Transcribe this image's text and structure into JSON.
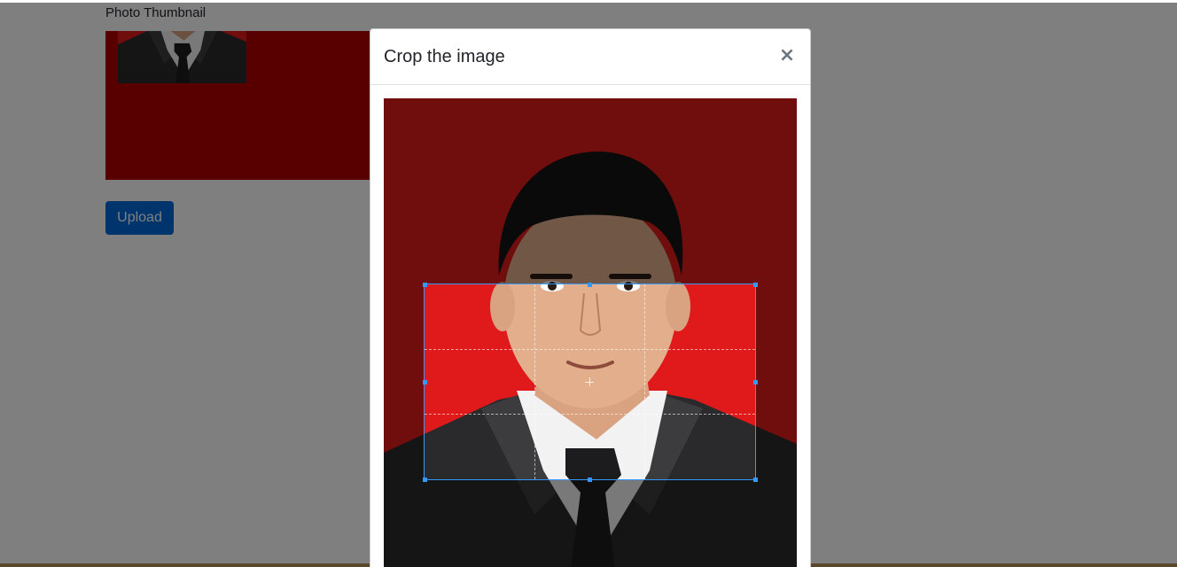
{
  "page": {
    "thumbnail_label": "Photo Thumbnail",
    "upload_label": "Upload"
  },
  "modal": {
    "title": "Crop the image",
    "close_glyph": "×"
  },
  "colors": {
    "accent": "#3399ff",
    "upload_button": "#0069d9",
    "photo_background": "#e01a1a",
    "backdrop": "rgba(0,0,0,0.5)"
  },
  "icons": {
    "close": "close-icon"
  }
}
